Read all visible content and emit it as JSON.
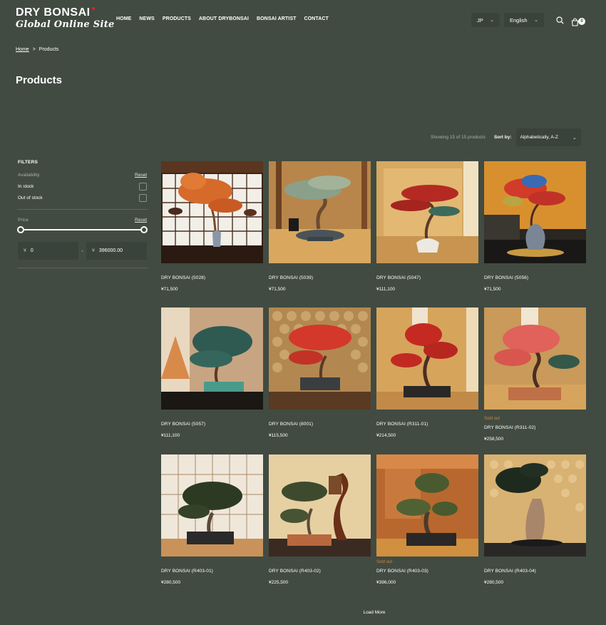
{
  "header": {
    "logo_main": "DRY BONSAI",
    "logo_sub": "Global Online Site",
    "nav": [
      "HOME",
      "NEWS",
      "PRODUCTS",
      "ABOUT DRYBONSAI",
      "BONSAI ARTIST",
      "CONTACT"
    ],
    "currency_select": "JP",
    "language_select": "English",
    "cart_count": "0"
  },
  "breadcrumb": {
    "home": "Home",
    "separator": ">",
    "current": "Products"
  },
  "page_title": "Products",
  "toolbar": {
    "showing": "Showing 15 of 15 products",
    "sort_label": "Sort by:",
    "sort_value": "Alphabetically, A-Z"
  },
  "filters": {
    "title": "FILTERS",
    "availability_label": "Availability",
    "availability_reset": "Reset",
    "options": [
      "In stock",
      "Out of stock"
    ],
    "price_label": "Price",
    "price_reset": "Reset",
    "currency_symbol": "¥",
    "min_value": "0",
    "max_value": "396000.00"
  },
  "products": [
    {
      "name": "DRY BONSAI (5028)",
      "price": "¥71,500",
      "sold_out": ""
    },
    {
      "name": "DRY BONSAI (5039)",
      "price": "¥71,500",
      "sold_out": ""
    },
    {
      "name": "DRY BONSAI (5047)",
      "price": "¥111,100",
      "sold_out": ""
    },
    {
      "name": "DRY BONSAI (5056)",
      "price": "¥71,500",
      "sold_out": ""
    },
    {
      "name": "DRY BONSAI (5057)",
      "price": "¥111,100",
      "sold_out": ""
    },
    {
      "name": "DRY BONSAI (8001)",
      "price": "¥115,500",
      "sold_out": ""
    },
    {
      "name": "DRY BONSAI (R311-01)",
      "price": "¥214,500",
      "sold_out": ""
    },
    {
      "name": "DRY BONSAI (R311-02)",
      "price": "¥258,500",
      "sold_out": "Sold out"
    },
    {
      "name": "DRY BONSAI (R403-01)",
      "price": "¥280,500",
      "sold_out": ""
    },
    {
      "name": "DRY BONSAI (R403-02)",
      "price": "¥225,500",
      "sold_out": ""
    },
    {
      "name": "DRY BONSAI (R403-03)",
      "price": "¥396,000",
      "sold_out": "Sold out"
    },
    {
      "name": "DRY BONSAI (R403-04)",
      "price": "¥280,500",
      "sold_out": ""
    }
  ],
  "load_more": "Load More",
  "colors": {
    "background": "#414b42",
    "input_bg": "#3a433b",
    "sold_out": "#c7893f",
    "logo_accent": "#d8262b"
  },
  "icons": [
    "search-icon",
    "cart-icon",
    "chevron-down-icon",
    "chevron-right-icon"
  ]
}
